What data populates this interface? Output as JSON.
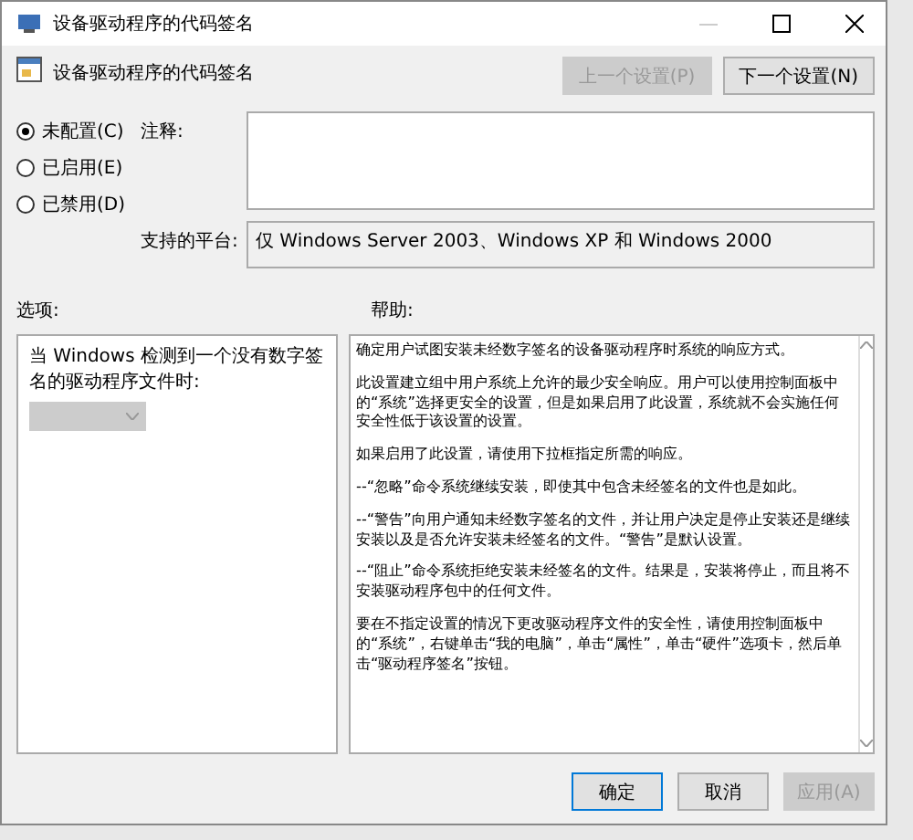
{
  "window": {
    "title": "设备驱动程序的代码签名"
  },
  "header": {
    "title": "设备驱动程序的代码签名",
    "buttons": [
      {
        "label": "上一个设置(P)",
        "disabled": true
      },
      {
        "label": "下一个设置(N)",
        "disabled": false
      }
    ]
  },
  "state_options": [
    {
      "label": "未配置(C)",
      "selected": true
    },
    {
      "label": "已启用(E)",
      "selected": false
    },
    {
      "label": "已禁用(D)",
      "selected": false
    }
  ],
  "comment": {
    "label": "注释:"
  },
  "platform": {
    "label": "支持的平台:",
    "value": "仅 Windows Server 2003、Windows XP 和 Windows 2000"
  },
  "options": {
    "label": "选项:",
    "prompt": "当 Windows 检测到一个没有数字签名的驱动程序文件时:",
    "dropdown_disabled": true
  },
  "help": {
    "label": "帮助:",
    "paragraphs": [
      "确定用户试图安装未经数字签名的设备驱动程序时系统的响应方式。",
      "此设置建立组中用户系统上允许的最少安全响应。用户可以使用控制面板中的“系统”选择更安全的设置，但是如果启用了此设置，系统就不会实施任何安全性低于该设置的设置。",
      "如果启用了此设置，请使用下拉框指定所需的响应。",
      "--“忽略”命令系统继续安装，即使其中包含未经签名的文件也是如此。",
      "--“警告”向用户通知未经数字签名的文件，并让用户决定是停止安装还是继续安装以及是否允许安装未经签名的文件。“警告”是默认设置。",
      "--“阻止”命令系统拒绝安装未经签名的文件。结果是，安装将停止，而且将不安装驱动程序包中的任何文件。",
      "要在不指定设置的情况下更改驱动程序文件的安全性，请使用控制面板中的“系统”，右键单击“我的电脑”，单击“属性”，单击“硬件”选项卡，然后单击“驱动程序签名”按钮。"
    ]
  },
  "footer_buttons": [
    {
      "label": "确定",
      "disabled": false
    },
    {
      "label": "取消",
      "disabled": false
    },
    {
      "label": "应用(A)",
      "disabled": true
    }
  ]
}
